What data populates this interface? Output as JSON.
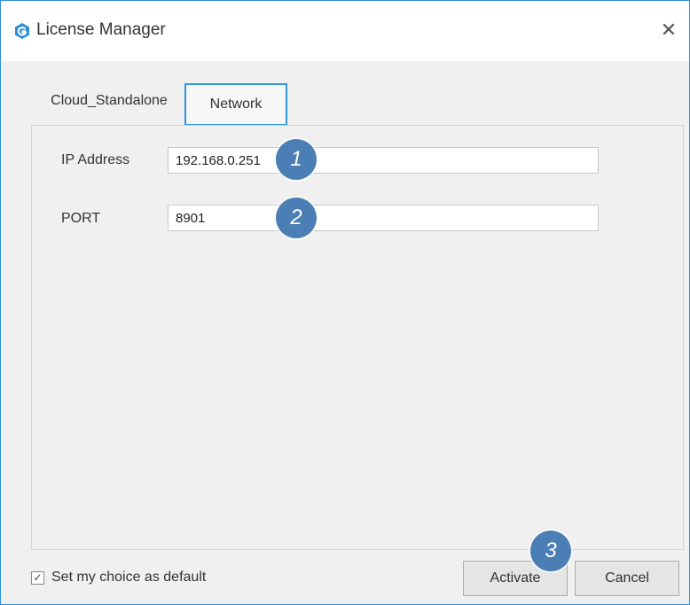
{
  "window": {
    "title": "License Manager",
    "close_glyph": "✕",
    "icon": "app-logo-icon"
  },
  "tabs": [
    {
      "label": "Cloud_Standalone",
      "selected": false
    },
    {
      "label": "Network",
      "selected": true
    }
  ],
  "form": {
    "ip_label": "IP Address",
    "ip_value": "192.168.0.251",
    "port_label": "PORT",
    "port_value": "8901"
  },
  "annotations": {
    "step1": "1",
    "step2": "2",
    "step3": "3"
  },
  "footer": {
    "default_checkbox_label": "Set my choice as default",
    "default_checked": true,
    "check_glyph": "✓",
    "activate_label": "Activate",
    "cancel_label": "Cancel"
  },
  "colors": {
    "accent": "#2f95dc",
    "badge": "#4a7eb4"
  }
}
